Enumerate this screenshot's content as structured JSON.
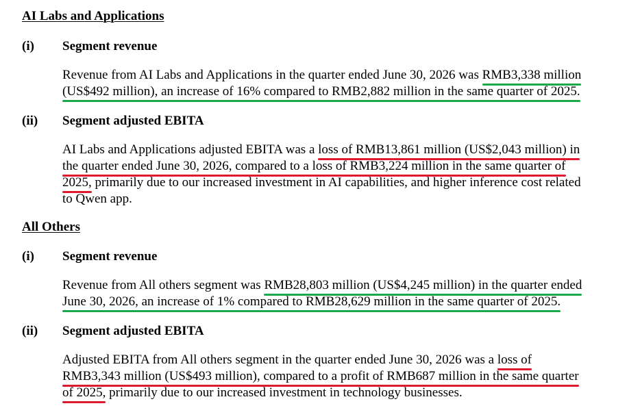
{
  "section_ai_labs": {
    "title": "AI Labs and Applications",
    "revenue": {
      "num": "(i)",
      "heading": "Segment revenue",
      "line1_plain": "Revenue from AI Labs and Applications in the quarter ended June 30, 2026 was ",
      "line1_hl": "RMB3,338 million",
      "line2_hl": "(US$492 million), an increase of 16% compared to RMB2,882 million in the same quarter of 2025."
    },
    "ebita": {
      "num": "(ii)",
      "heading": "Segment adjusted EBITA",
      "line1_plain": "AI Labs and Applications adjusted EBITA was a ",
      "line1_hl": "loss of RMB13,861 million (US$2,043 million) in",
      "line2_hl": "the quarter ended June 30, 2026, compared to a loss of RMB3,224 million in the same quarter of",
      "line3_hl": "2025,",
      "line3_plain": " primarily due to our increased investment in AI capabilities, and higher inference cost related",
      "line4_plain": "to Qwen app."
    }
  },
  "section_all_others": {
    "title": "All Others",
    "revenue": {
      "num": "(i)",
      "heading": "Segment revenue",
      "line1_plain": "Revenue from All others segment was ",
      "line1_hl": "RMB28,803 million (US$4,245 million) in the quarter ended",
      "line2_hl": "June 30, 2026, an increase of 1% compared to RMB28,629 million in the same quarter of 2025."
    },
    "ebita": {
      "num": "(ii)",
      "heading": "Segment adjusted EBITA",
      "line1_plain": "Adjusted EBITA from All others segment in the quarter ended June 30, 2026 was a ",
      "line1_hl": "loss of",
      "line2_hl": "RMB3,343 million (US$493 million), compared to a profit of RMB687 million in the same quarter",
      "line3_hl": "of 2025,",
      "line3_plain": " primarily due to our increased investment in technology businesses."
    }
  },
  "colors": {
    "highlight_positive": "#1aa84a",
    "highlight_negative": "#e0182d",
    "text": "#000000",
    "background": "#ffffff"
  }
}
